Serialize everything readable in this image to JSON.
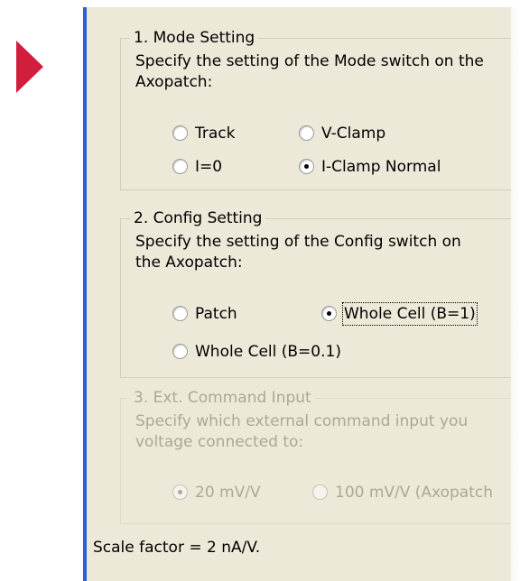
{
  "mode_group": {
    "title": "1. Mode Setting",
    "desc_line1": "Specify the setting of the Mode switch on the",
    "desc_line2": "Axopatch:",
    "options": [
      {
        "label": "Track",
        "checked": false
      },
      {
        "label": "V-Clamp",
        "checked": false
      },
      {
        "label": "I=0",
        "checked": false
      },
      {
        "label": "I-Clamp Normal",
        "checked": true
      }
    ]
  },
  "config_group": {
    "title": "2. Config Setting",
    "desc_line1": "Specify the setting of the Config switch on",
    "desc_line2": "the Axopatch:",
    "options": [
      {
        "label": "Patch",
        "checked": false
      },
      {
        "label": "Whole Cell (B=1)",
        "checked": true
      },
      {
        "label": "Whole Cell (B=0.1)",
        "checked": false
      }
    ]
  },
  "ext_group": {
    "title": "3. Ext. Command Input",
    "desc_line1": "Specify which external command input you",
    "desc_line2": "voltage connected to:",
    "disabled": true,
    "options": [
      {
        "label": "20 mV/V",
        "checked": true
      },
      {
        "label": "100 mV/V (Axopatch",
        "checked": false
      }
    ]
  },
  "scale_factor": "Scale factor = 2 nA/V.",
  "colors": {
    "arrow": "#d01e3c",
    "dialog_bg": "#ece9d8",
    "accent_line": "#2a62d8"
  }
}
